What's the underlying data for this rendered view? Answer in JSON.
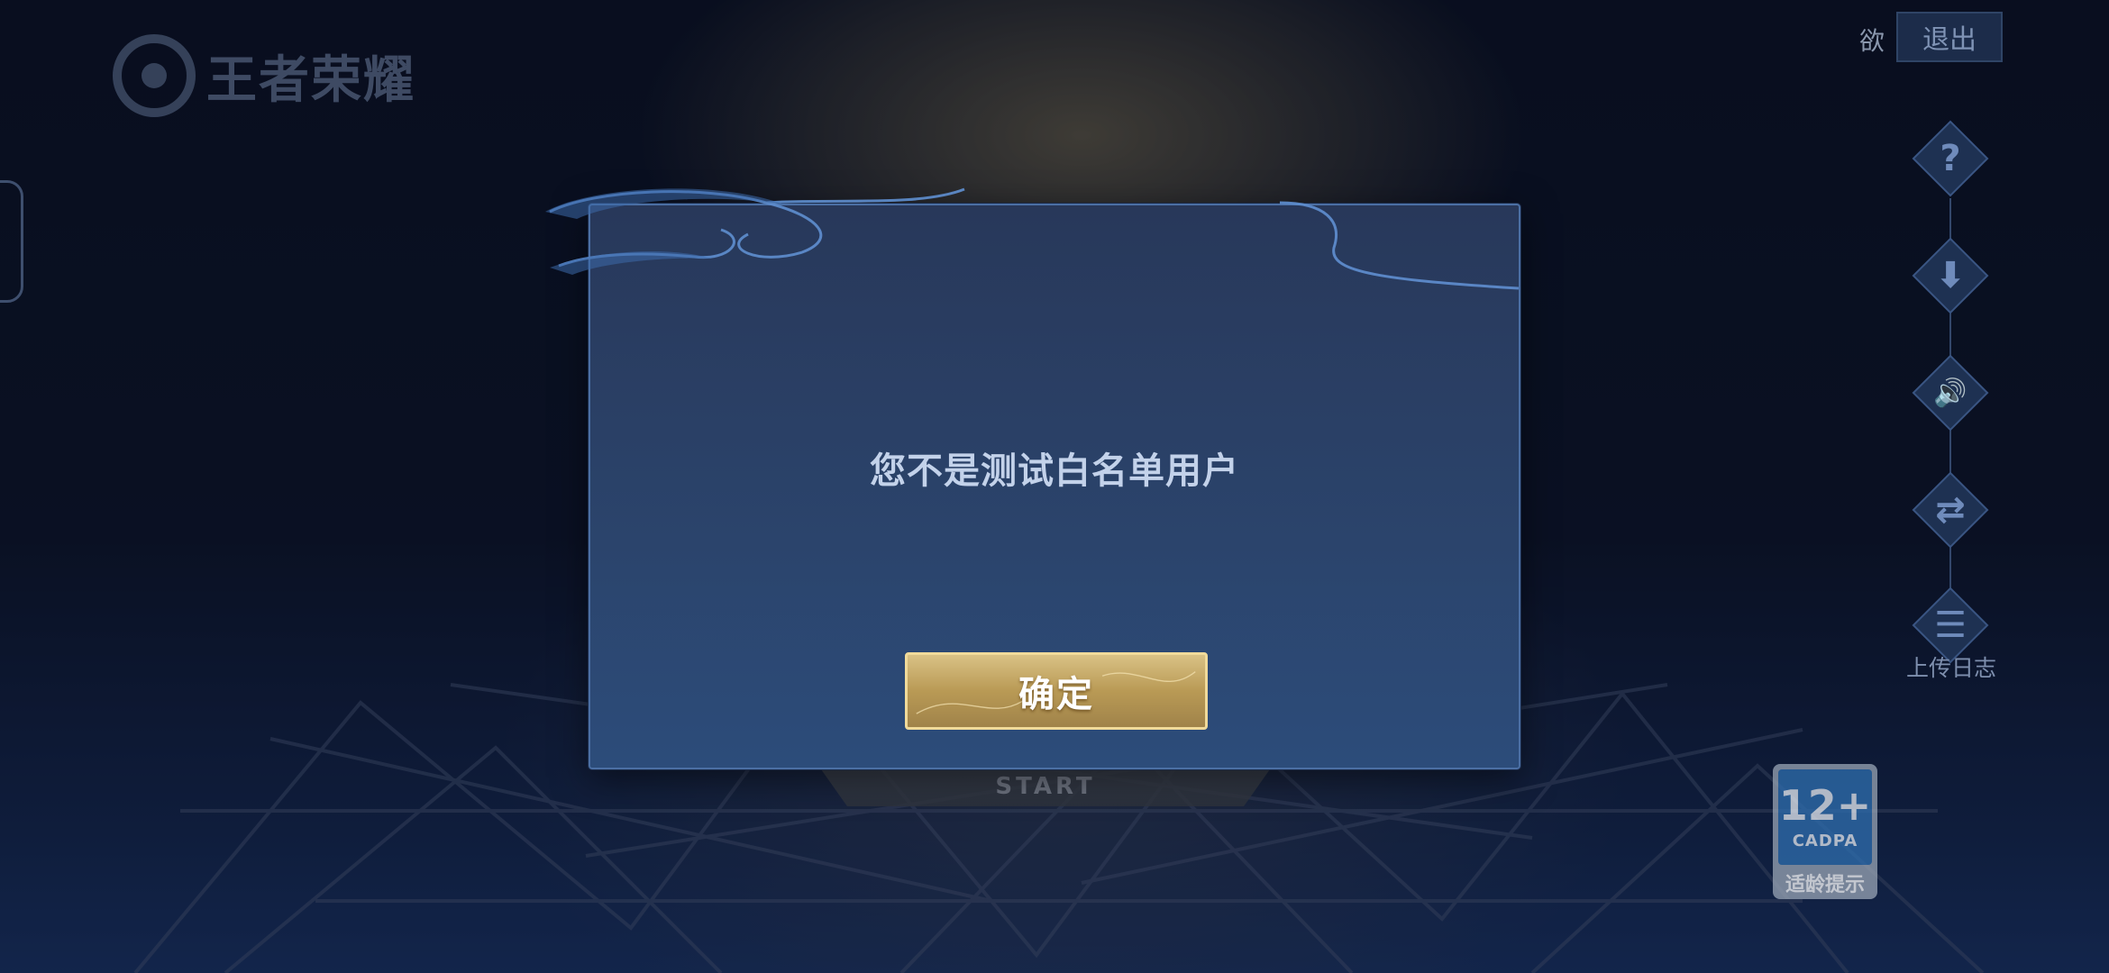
{
  "app": {
    "logo_text": "王者荣耀"
  },
  "header": {
    "side_text": "欲",
    "exit_label": "退出"
  },
  "toolbar": {
    "items": [
      {
        "icon": "help-icon",
        "glyph": "?"
      },
      {
        "icon": "download-icon",
        "glyph": "⬇"
      },
      {
        "icon": "sound-icon",
        "glyph": "🔊"
      },
      {
        "icon": "switch-account-icon",
        "glyph": "⇄"
      },
      {
        "icon": "upload-log-icon",
        "glyph": "☰"
      }
    ],
    "upload_log_label": "上传日志"
  },
  "age_rating": {
    "age": "12+",
    "org": "CADPA",
    "tip": "适龄提示"
  },
  "start_button": {
    "sub_label": "START"
  },
  "dialog": {
    "message": "您不是测试白名单用户",
    "confirm_label": "确定"
  },
  "colors": {
    "dialog_bg": "#2b446c",
    "dialog_border": "#4b6fa4",
    "confirm_gold": "#b99a55",
    "message_text": "#c3d2ea"
  }
}
